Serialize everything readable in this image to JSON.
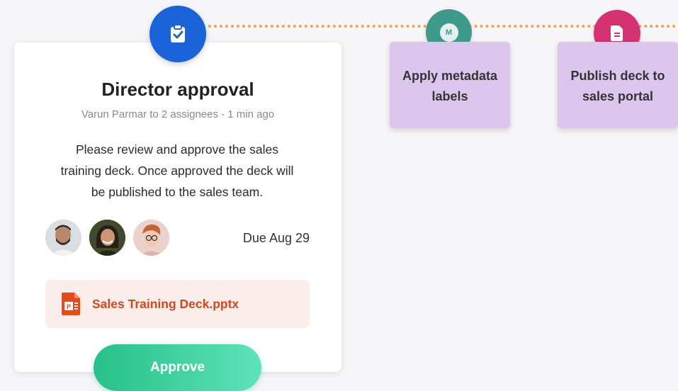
{
  "task": {
    "title": "Director approval",
    "meta": "Varun Parmar to 2 assignees  - 1 min ago",
    "description": "Please review and approve the sales training deck. Once approved the deck will be published to the sales team.",
    "due": "Due Aug 29",
    "attachment": {
      "name": "Sales Training Deck.pptx",
      "icon": "powerpoint-file-icon"
    },
    "approve_label": "Approve",
    "step_icon": "clipboard-check-icon"
  },
  "steps": [
    {
      "label_lines": [
        "Apply metadata",
        "labels"
      ],
      "icon": "metadata-m-icon",
      "icon_glyph": "M"
    },
    {
      "label_lines": [
        "Publish deck to",
        "sales portal"
      ],
      "icon": "document-icon"
    }
  ],
  "colors": {
    "connector": "#f4a14c",
    "main_step": "#1b63d8",
    "metadata_step": "#3f9a8c",
    "publish_step": "#d53272",
    "step_box": "#ddc6ee",
    "approve_start": "#27c08a",
    "approve_end": "#5ee3b8",
    "attachment_text": "#d4471e"
  }
}
